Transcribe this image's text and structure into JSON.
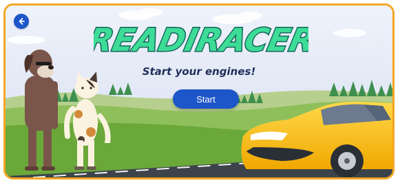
{
  "app": {
    "logo_text": "READIRACER",
    "subtitle": "Start your engines!"
  },
  "buttons": {
    "start_label": "Start",
    "back_icon": "arrow-left-icon"
  },
  "colors": {
    "frame_border": "#f5a623",
    "button_blue": "#1d56c8",
    "logo_green": "#3ddc97",
    "subtitle_navy": "#1f2f5c",
    "car_yellow": "#f8c21a"
  }
}
